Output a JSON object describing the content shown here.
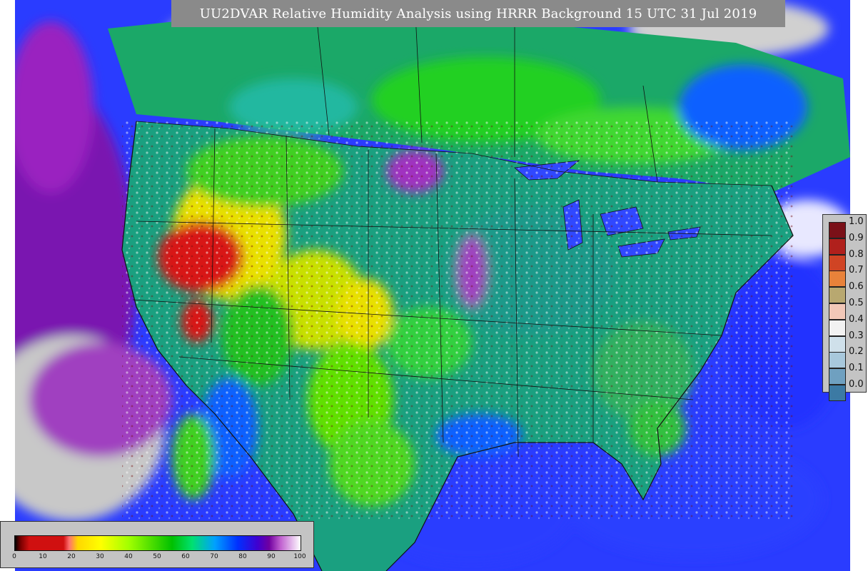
{
  "title": "UU2DVAR Relative Humidity Analysis using HRRR Background 15 UTC 31 Jul 2019",
  "rh_legend": {
    "labels": [
      "1.0",
      "0.9",
      "0.8",
      "0.7",
      "0.6",
      "0.5",
      "0.4",
      "0.3",
      "0.2",
      "0.1",
      "0.0"
    ],
    "colors": [
      "#7a1018",
      "#b0201c",
      "#d04424",
      "#e8823a",
      "#b8a870",
      "#f2c8b8",
      "#f2f2f2",
      "#cfe0ea",
      "#a8c8dc",
      "#6fa0c0",
      "#3c7aa4",
      "#0d3e6a"
    ]
  },
  "percent_bar": {
    "ticks": [
      "0",
      "10",
      "20",
      "30",
      "40",
      "50",
      "60",
      "70",
      "80",
      "90",
      "100"
    ]
  },
  "palette": {
    "ocean": "#2038ff",
    "ocean_far": "#7a14b0",
    "land_base": "#1aa080",
    "dry_green": "#2ee010",
    "very_dry": "#e8e000",
    "extreme_dry": "#d81818",
    "moist_blue": "#1060ff",
    "no_data": "#c8c8c8"
  }
}
